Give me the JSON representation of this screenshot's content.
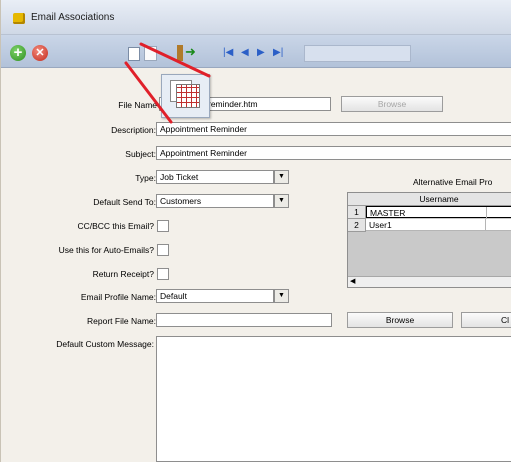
{
  "window": {
    "title": "Email Associations"
  },
  "toolbar": {
    "add_label": "+",
    "delete_label": "✕",
    "nav": [
      "|◀",
      "◀",
      "▶",
      "▶|"
    ]
  },
  "form": {
    "file_name": {
      "label": "File Name",
      "value": "reminder.htm",
      "browse_label": "Browse"
    },
    "description": {
      "label": "Description:",
      "value": "Appointment Reminder"
    },
    "subject": {
      "label": "Subject:",
      "value": "Appointment Reminder"
    },
    "type": {
      "label": "Type:",
      "value": "Job Ticket"
    },
    "default_send_to": {
      "label": "Default Send To:",
      "value": "Customers"
    },
    "ccbcc": {
      "label": "CC/BCC this Email?"
    },
    "auto_emails": {
      "label": "Use this for Auto-Emails?"
    },
    "return_receipt": {
      "label": "Return Receipt?"
    },
    "email_profile": {
      "label": "Email Profile Name:",
      "value": "Default"
    },
    "report_file": {
      "label": "Report File Name:",
      "value": "",
      "browse_label": "Browse",
      "clear_label": "Cl"
    },
    "custom_message": {
      "label": "Default Custom Message:"
    }
  },
  "alt_profiles": {
    "title": "Alternative Email Pro",
    "column": "Username",
    "rows": [
      {
        "num": "1",
        "username": "MASTER"
      },
      {
        "num": "2",
        "username": "User1"
      }
    ],
    "scroll_left": "◀"
  },
  "colors": {
    "annotation_arrow": "#e0202a",
    "toolbar": "#b2c2d9"
  }
}
